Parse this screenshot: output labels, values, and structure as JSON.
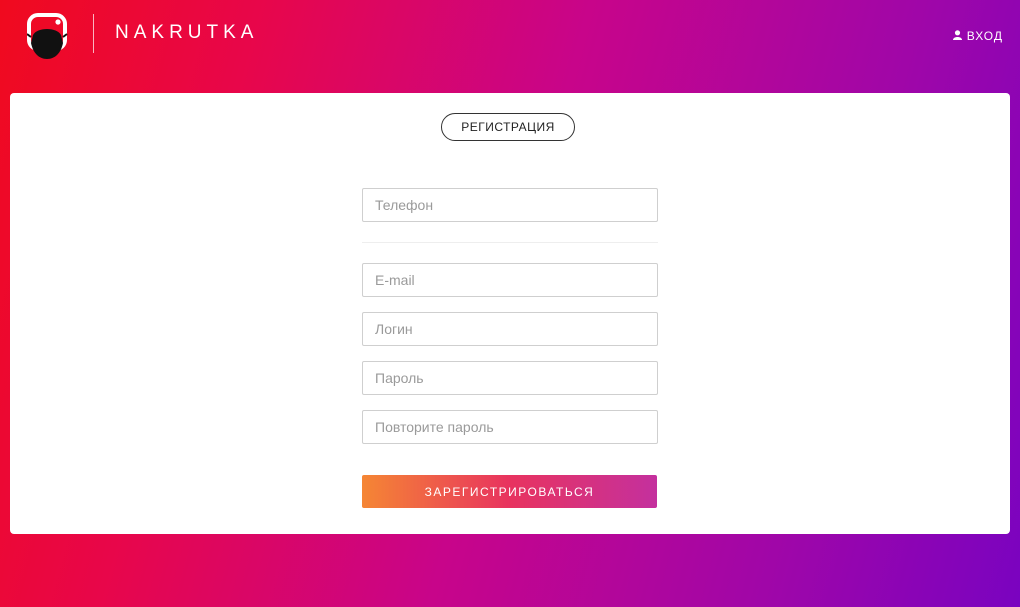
{
  "header": {
    "brand": "NAKRUTKA",
    "login_label": "ВХОД"
  },
  "card": {
    "tab_label": "РЕГИСТРАЦИЯ"
  },
  "form": {
    "phone_placeholder": "Телефон",
    "email_placeholder": "E-mail",
    "login_placeholder": "Логин",
    "password_placeholder": "Пароль",
    "repeat_password_placeholder": "Повторите пароль",
    "submit_label": "ЗАРЕГИСТРИРОВАТЬСЯ"
  },
  "icons": {
    "logo": "instagram-mask-logo-icon",
    "user": "user-icon"
  },
  "colors": {
    "bg_start": "#f00a1e",
    "bg_mid": "#c8058a",
    "bg_end": "#7a03c0",
    "button_start": "#f58634",
    "button_end": "#c4309e"
  }
}
